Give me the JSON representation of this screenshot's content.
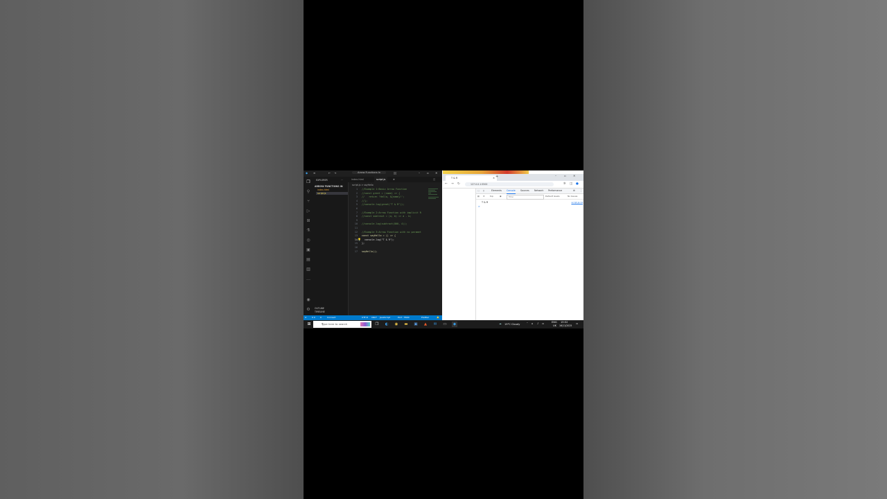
{
  "colors": {
    "vscode_bg": "#1e1e1e",
    "status_bar": "#007acc",
    "taskbar": "#1c1c1c",
    "accent": "#1a73e8"
  },
  "vscode": {
    "title": "Arrow Functions In",
    "explorer_header": "EXPLORER",
    "folder": "ARROW FUNCTIONS IN",
    "files": [
      "index.html",
      "script.js"
    ],
    "outline": "OUTLINE",
    "timeline": "TIMELINE",
    "tabs": [
      "index.html",
      "script.js"
    ],
    "breadcrumb": "script.js > sayHello",
    "code_lines": [
      "//Example 1:Basic Arrow Function",
      "//const greet = (name) => {",
      "//   return 'Hello, ${name}!';",
      "//};",
      "//console.log(greet(\"T & R\"));",
      "",
      "//Example 2:Arrow Function with implicit R",
      "//const subtract = (a, b) => a - b;",
      "",
      "//console.log(subtract(800, 4));",
      "",
      "//Example 3:Arrow Function with no paramet",
      "const sayHello = () => {",
      "  console.log(\"T & R\");",
      "};",
      "",
      "sayHello();"
    ],
    "status": {
      "errors": "0 0",
      "warnings": "0",
      "connect": "Connect",
      "encoding": "UTF-8",
      "eol": "CRLF",
      "language": "JavaScript",
      "port": "Port : 5500",
      "prettier": "Prettier"
    }
  },
  "browser": {
    "tab_title": "T & R",
    "url": "127.0.0.1:5500",
    "devtools_tabs": [
      "Elements",
      "Console",
      "Sources",
      "Network",
      "Performance"
    ],
    "context": "top",
    "filter_placeholder": "Filter",
    "levels": "Default levels",
    "issues": "No Issues",
    "console_output": "T & R",
    "console_source": "script.js:14",
    "prompt": ">"
  },
  "taskbar": {
    "search_placeholder": "Type here to search",
    "weather": "19°C Cloudy",
    "language": "ENG",
    "region": "UK",
    "time": "19:52",
    "date": "16/11/2025"
  }
}
